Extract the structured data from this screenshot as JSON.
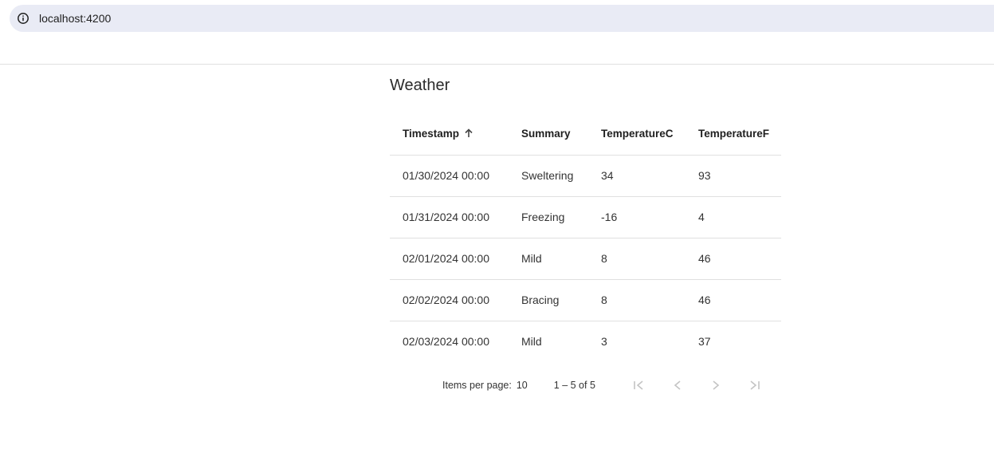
{
  "browser": {
    "url": "localhost:4200",
    "icon": "info-icon"
  },
  "page": {
    "title": "Weather"
  },
  "table": {
    "columns": [
      "Timestamp",
      "Summary",
      "TemperatureC",
      "TemperatureF"
    ],
    "sort": {
      "column": "Timestamp",
      "direction": "ascending",
      "icon": "arrow-up-icon"
    },
    "rows": [
      [
        "01/30/2024 00:00",
        "Sweltering",
        "34",
        "93"
      ],
      [
        "01/31/2024 00:00",
        "Freezing",
        "-16",
        "4"
      ],
      [
        "02/01/2024 00:00",
        "Mild",
        "8",
        "46"
      ],
      [
        "02/02/2024 00:00",
        "Bracing",
        "8",
        "46"
      ],
      [
        "02/03/2024 00:00",
        "Mild",
        "3",
        "37"
      ]
    ]
  },
  "paginator": {
    "items_per_page_label": "Items per page:",
    "items_per_page_value": "10",
    "range_label": "1 – 5 of 5",
    "icons": [
      "first-page-icon",
      "previous-page-icon",
      "next-page-icon",
      "last-page-icon"
    ],
    "disabled_color": "#c4c4c4"
  }
}
